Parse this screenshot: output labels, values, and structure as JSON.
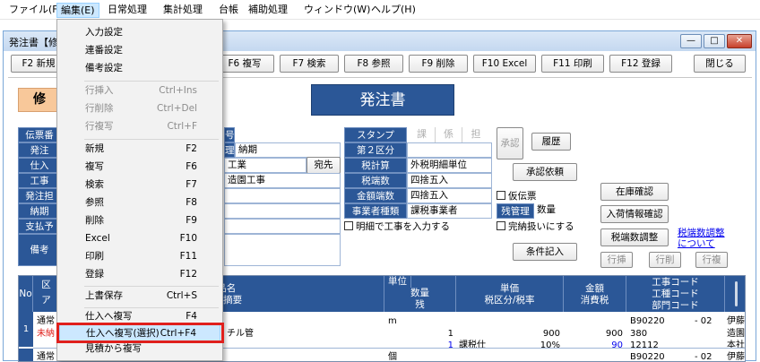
{
  "menubar": {
    "items": [
      "ファイル(F)",
      "編集(E)",
      "日常処理",
      "集計処理",
      "台帳",
      "補助処理",
      "ウィンドウ(W)",
      "ヘルプ(H)"
    ]
  },
  "window": {
    "title": "発注書【修",
    "min": "—",
    "max": "□",
    "close": "✕"
  },
  "fkeys": {
    "f2": "F2 新規",
    "f6": "F6 複写",
    "f7": "F7 検索",
    "f8": "F8 参照",
    "f9": "F9 削除",
    "f10": "F10 Excel",
    "f11": "F11 印刷",
    "f12": "F12 登録",
    "close": "閉じる"
  },
  "form": {
    "title": "発注書",
    "mode": "修",
    "labels": [
      "伝票番",
      "発注",
      "仕入",
      "工事",
      "発注担",
      "納期",
      "支払予"
    ],
    "memo_label": "備考",
    "mid_labels": [
      "号",
      "理"
    ],
    "noki": "納期",
    "kogyo": "工業",
    "atesaki": "宛先",
    "koji": "造園工事",
    "stamp_label": "スタンプ",
    "stamps": [
      "課",
      "係",
      "担"
    ],
    "kubun2_label": "第２区分",
    "zei_label": "税計算",
    "zei_val": "外税明細単位",
    "hasu_label": "税端数",
    "hasu_val": "四捨五入",
    "kin_label": "金額端数",
    "kin_val": "四捨五入",
    "jig_label": "事業者種類",
    "jig_val": "課税事業者",
    "meisai_chk": "明細で工事を入力する",
    "shonin": "承認",
    "rireki": "履歴",
    "shonin_irai": "承認依頼",
    "karidenpyo": "仮伝票",
    "zan_label": "残管理",
    "zan_val": "数量",
    "kanno": "完納扱いにする",
    "joken": "条件記入",
    "zaiko": "在庫確認",
    "nyuka": "入荷情報確認",
    "zeihasu_btn": "税端数調整",
    "link": "税端数調整について",
    "gyo_sonyu": "行挿",
    "gyo_sakujo": "行削",
    "gyo_fukusha": "行複"
  },
  "grid": {
    "headers": {
      "no": "No",
      "kubun_a": "区",
      "kubun_b": "ア",
      "name": "商品名",
      "spec": "仕様 摘要",
      "unit": "単位",
      "qty": "数量",
      "zan": "残",
      "price": "単価",
      "zeiku": "税区分/税率",
      "amount": "金額",
      "zeigaku": "消費税",
      "koji_code": "工事コード",
      "koji_sub": "工種コード",
      "bumon": "部門コード"
    },
    "row1": {
      "no": "1",
      "type": "通常",
      "status": "未納",
      "item": "チル管",
      "unit": "m",
      "qty": "1",
      "price": "900",
      "amount": "900",
      "qty2": "1",
      "zei": "課税仕",
      "rate": "10%",
      "tax": "90",
      "code": "B90220",
      "sub": "- 02",
      "code2": "380",
      "code3": "12112",
      "who": "伊藤",
      "who2": "造園",
      "who3": "本社"
    },
    "row2": {
      "type": "通常",
      "unit": "個",
      "code": "B90220",
      "sub": "- 02",
      "who": "伊藤"
    }
  },
  "menu": {
    "items": [
      {
        "label": "入力設定",
        "shortcut": ""
      },
      {
        "label": "連番設定",
        "shortcut": ""
      },
      {
        "label": "備考設定",
        "shortcut": ""
      },
      {
        "label": "行挿入",
        "shortcut": "Ctrl+Ins"
      },
      {
        "label": "行削除",
        "shortcut": "Ctrl+Del"
      },
      {
        "label": "行複写",
        "shortcut": "Ctrl+F"
      },
      {
        "label": "新規",
        "shortcut": "F2"
      },
      {
        "label": "複写",
        "shortcut": "F6"
      },
      {
        "label": "検索",
        "shortcut": "F7"
      },
      {
        "label": "参照",
        "shortcut": "F8"
      },
      {
        "label": "削除",
        "shortcut": "F9"
      },
      {
        "label": "Excel",
        "shortcut": "F10"
      },
      {
        "label": "印刷",
        "shortcut": "F11"
      },
      {
        "label": "登録",
        "shortcut": "F12"
      },
      {
        "label": "上書保存",
        "shortcut": "Ctrl+S"
      },
      {
        "label": "仕入へ複写",
        "shortcut": "F4"
      },
      {
        "label": "仕入へ複写(選択)",
        "shortcut": "Ctrl+F4"
      },
      {
        "label": "見積から複写",
        "shortcut": ""
      }
    ]
  },
  "colors": {
    "header_blue": "#2b5797",
    "highlight_red": "#e0201c",
    "menu_select": "#cce8ff",
    "mode_orange": "#f8c89a"
  }
}
